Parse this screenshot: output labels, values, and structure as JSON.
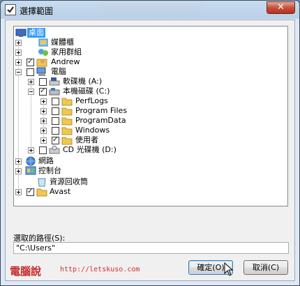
{
  "window": {
    "title": "選擇範圍"
  },
  "tree": {
    "items": [
      {
        "label": "桌面",
        "selected": true
      },
      {
        "label": "媒體櫃"
      },
      {
        "label": "家用群組"
      },
      {
        "label": "Andrew"
      },
      {
        "label": "電腦"
      },
      {
        "label": "軟碟機 (A:)"
      },
      {
        "label": "本機磁碟 (C:)"
      },
      {
        "label": "PerfLogs"
      },
      {
        "label": "Program Files"
      },
      {
        "label": "ProgramData"
      },
      {
        "label": "Windows"
      },
      {
        "label": "使用者"
      },
      {
        "label": "CD 光碟機 (D:)"
      },
      {
        "label": "網路"
      },
      {
        "label": "控制台"
      },
      {
        "label": "資源回收筒"
      },
      {
        "label": "Avast"
      }
    ]
  },
  "path": {
    "label": "選取的路徑(S):",
    "value": "\"C:\\Users\""
  },
  "buttons": {
    "ok": "確定(O)",
    "cancel": "取消(C)"
  },
  "watermark": {
    "name": "電腦說",
    "url": "http://letskuso.com"
  },
  "colors": {
    "selection": "#3399ff",
    "watermark": "#c62828",
    "folder": "#f0c850"
  }
}
